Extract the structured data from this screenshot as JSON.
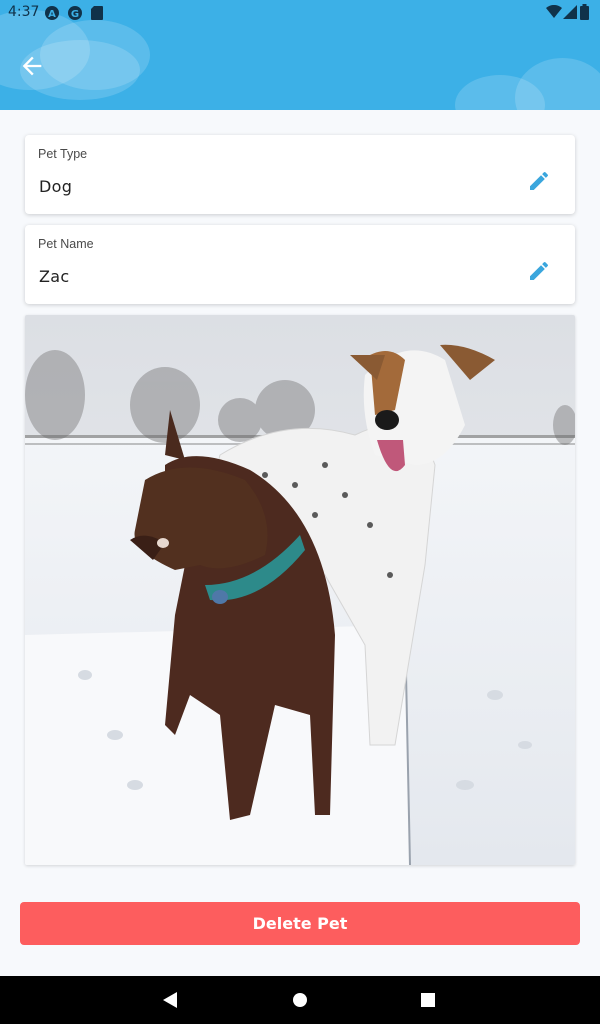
{
  "status_bar": {
    "time": "4:37",
    "left_icons": [
      "a-circle-icon",
      "g-circle-icon",
      "sd-card-icon"
    ],
    "right_icons": [
      "wifi-icon",
      "cell-signal-icon",
      "battery-icon"
    ]
  },
  "header": {
    "back_icon": "arrow-left-icon",
    "background_color": "#3cb0e7"
  },
  "fields": {
    "pet_type": {
      "label": "Pet Type",
      "value": "Dog",
      "edit_icon": "pencil-icon"
    },
    "pet_name": {
      "label": "Pet Name",
      "value": "Zac",
      "edit_icon": "pencil-icon"
    }
  },
  "photo": {
    "content": "photo"
  },
  "actions": {
    "delete_label": "Delete Pet",
    "delete_color": "#fd5d5e"
  },
  "nav_bar": {
    "icons": [
      "back-triangle-icon",
      "home-circle-icon",
      "recents-square-icon"
    ]
  },
  "colors": {
    "accent": "#3cb0e7",
    "edit_icon": "#3aa6dd"
  }
}
